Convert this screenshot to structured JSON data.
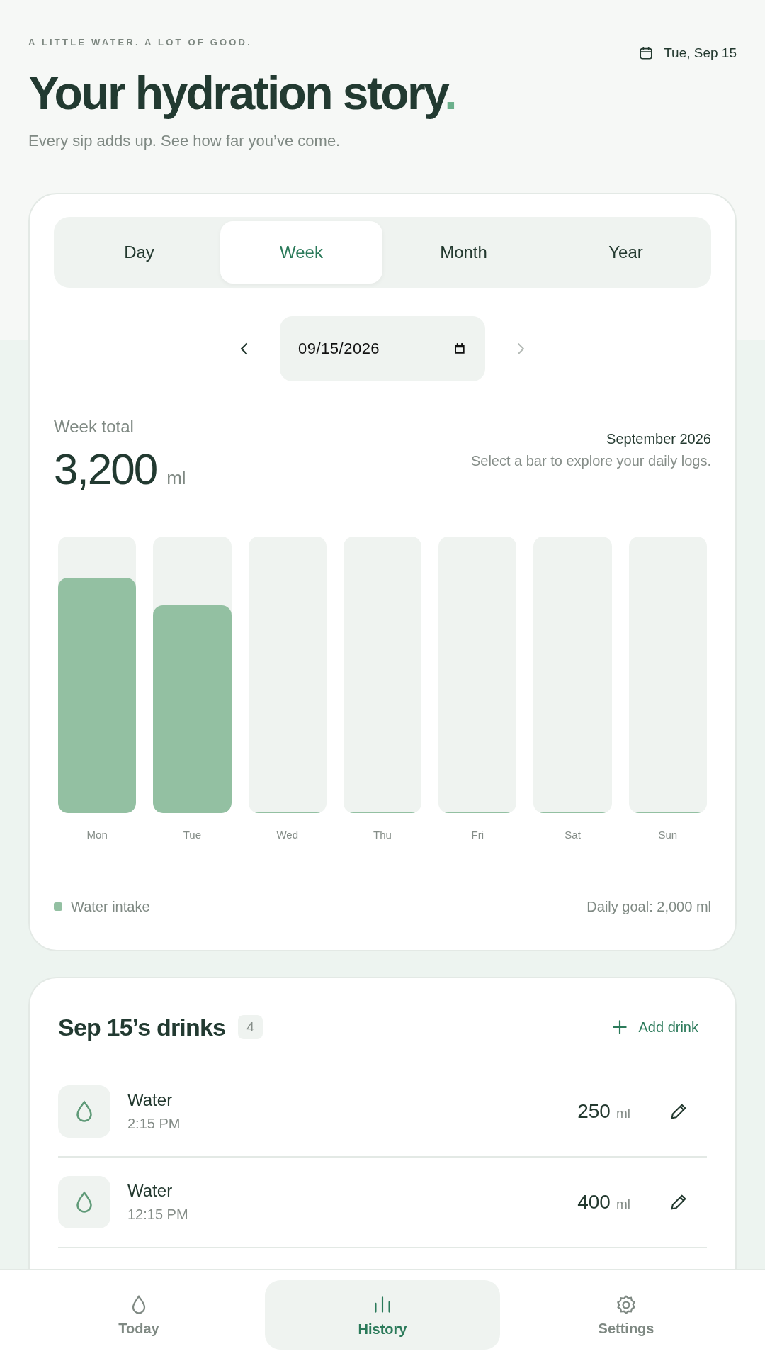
{
  "header": {
    "tagline": "A LITTLE WATER. A LOT OF GOOD.",
    "title": "Your hydration story",
    "title_dot": ".",
    "subtitle": "Every sip adds up. See how far you’ve come.",
    "date": "Tue, Sep 15"
  },
  "tabs": [
    {
      "label": "Day",
      "selected": false
    },
    {
      "label": "Week",
      "selected": true
    },
    {
      "label": "Month",
      "selected": false
    },
    {
      "label": "Year",
      "selected": false
    }
  ],
  "date_picker": {
    "value": "09/15/2026",
    "next_disabled": true
  },
  "summary": {
    "label": "Week total",
    "value": "3,200",
    "unit": "ml",
    "month": "September 2026",
    "hint": "Select a bar to explore your daily logs."
  },
  "days": [
    {
      "label": "Mon",
      "level": 0.85
    },
    {
      "label": "Tue",
      "level": 0.75
    },
    {
      "label": "Wed",
      "level": 0
    },
    {
      "label": "Thu",
      "level": 0
    },
    {
      "label": "Fri",
      "level": 0
    },
    {
      "label": "Sat",
      "level": 0
    },
    {
      "label": "Sun",
      "level": 0
    }
  ],
  "legend": {
    "label": "Water intake",
    "color": "#93c0a2",
    "goal": "Daily goal: 2,000 ml"
  },
  "drinks": {
    "title": "Sep 15’s drinks",
    "count": "4",
    "add_label": "Add drink",
    "items": [
      {
        "name": "Water",
        "time": "2:15 PM",
        "amount": "250",
        "unit": "ml"
      },
      {
        "name": "Water",
        "time": "12:15 PM",
        "amount": "400",
        "unit": "ml"
      }
    ]
  },
  "nav": [
    {
      "label": "Today",
      "kind": "drop",
      "selected": false
    },
    {
      "label": "History",
      "kind": "bars",
      "selected": true
    },
    {
      "label": "Settings",
      "kind": "gear",
      "selected": false
    }
  ]
}
